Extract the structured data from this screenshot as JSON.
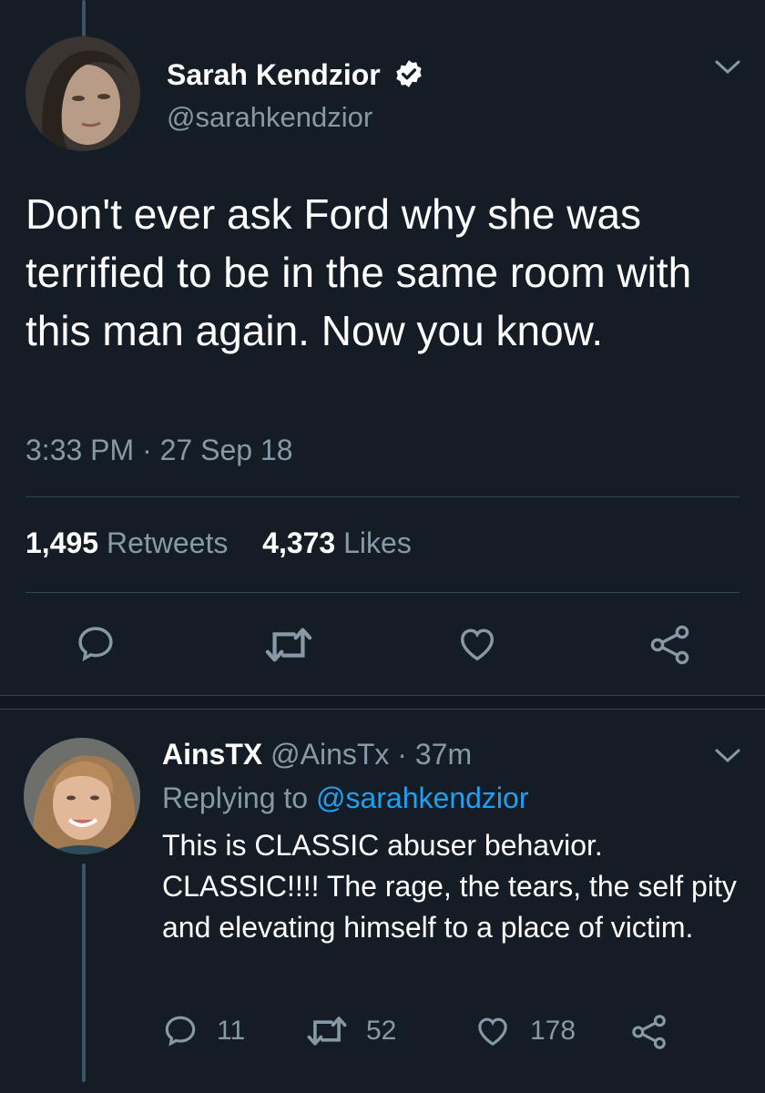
{
  "main_tweet": {
    "display_name": "Sarah Kendzior",
    "handle": "@sarahkendzior",
    "verified_icon": "verified-badge-icon",
    "text": "Don't ever ask Ford why she was terrified to be in the same room with this man again. Now you know.",
    "timestamp": "3:33 PM · 27 Sep 18",
    "stats": {
      "retweets_count": "1,495",
      "retweets_label": "Retweets",
      "likes_count": "4,373",
      "likes_label": "Likes"
    },
    "actions": [
      "reply-icon",
      "retweet-icon",
      "like-icon",
      "share-icon"
    ]
  },
  "reply_tweet": {
    "display_name": "AinsTX",
    "handle": "@AinsTx",
    "time": "· 37m",
    "replying_prefix": "Replying to",
    "replying_to": "@sarahkendzior",
    "text": "This is CLASSIC abuser behavior. CLASSIC!!!! The rage, the tears, the self pity and elevating himself to a place of victim.",
    "actions": {
      "reply_count": "11",
      "retweet_count": "52",
      "like_count": "178"
    }
  },
  "colors": {
    "background": "#141d26",
    "text": "#ffffff",
    "muted": "#8899a6",
    "link": "#1da1f2",
    "divider": "#38444d"
  }
}
